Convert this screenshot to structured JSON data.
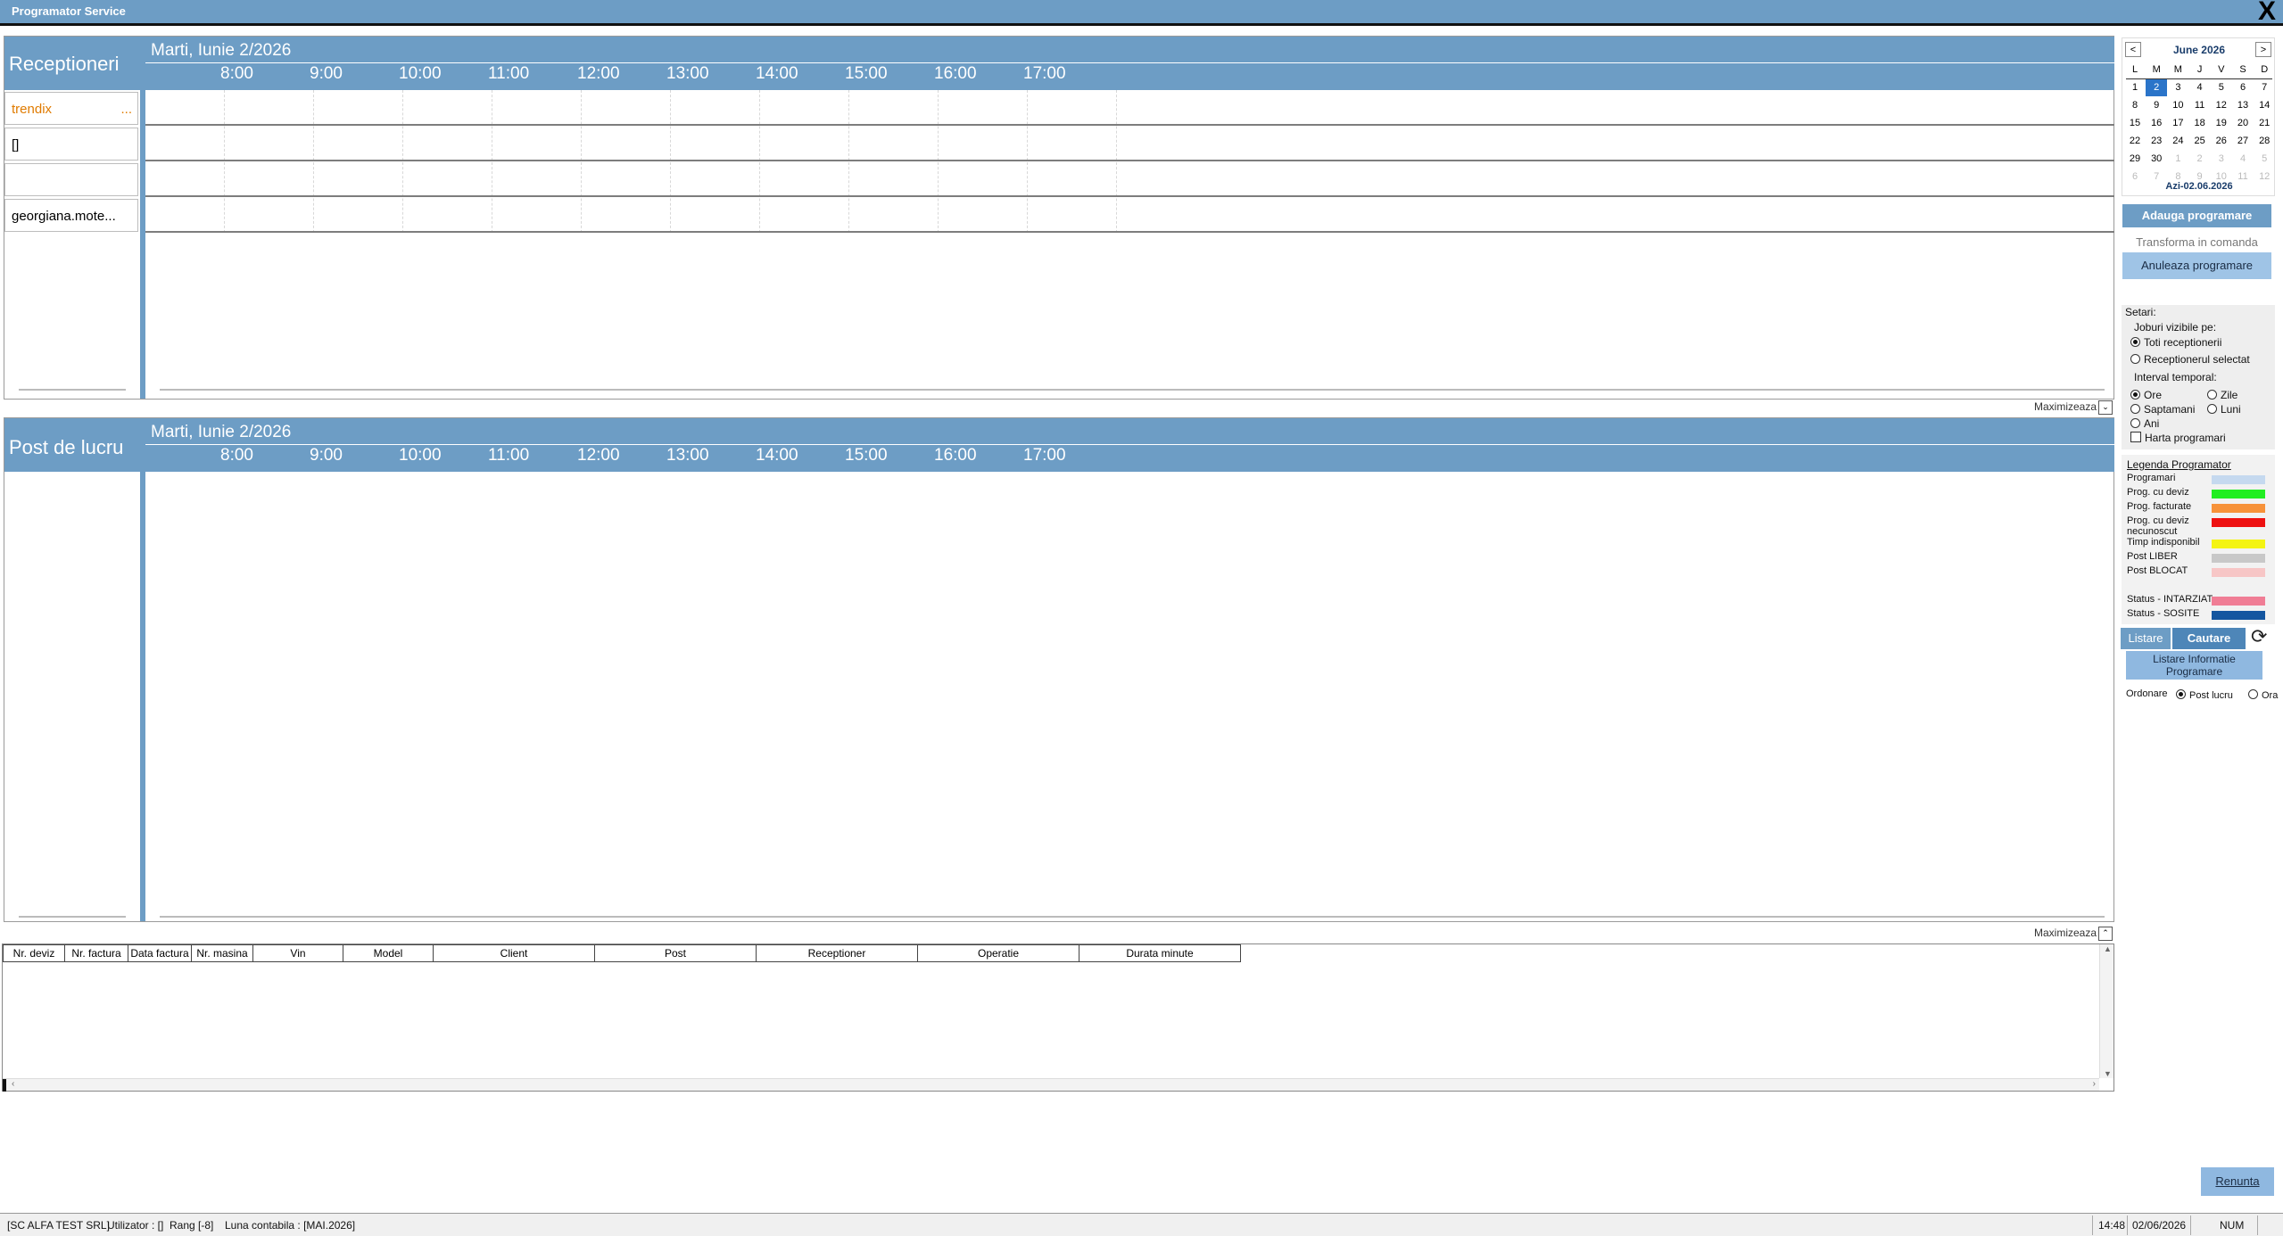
{
  "window": {
    "title": "Programator Service",
    "close_label": "X"
  },
  "top_panel": {
    "label": "Receptioneri",
    "date": "Marti, Iunie 2/2026",
    "hours": [
      "8:00",
      "9:00",
      "10:00",
      "11:00",
      "12:00",
      "13:00",
      "14:00",
      "15:00",
      "16:00",
      "17:00"
    ],
    "receptioneri": [
      {
        "name": "trendix",
        "more": "...",
        "color": "#e07b00"
      },
      {
        "name": "[]",
        "more": "",
        "color": "#000000"
      },
      {
        "name": "",
        "more": "",
        "color": "#000000"
      },
      {
        "name": "georgiana.mote...",
        "more": "",
        "color": "#000000"
      }
    ],
    "maximize_label": "Maximizeaza"
  },
  "bottom_panel": {
    "label": "Post de lucru",
    "date": "Marti, Iunie 2/2026",
    "hours": [
      "8:00",
      "9:00",
      "10:00",
      "11:00",
      "12:00",
      "13:00",
      "14:00",
      "15:00",
      "16:00",
      "17:00"
    ],
    "maximize_label": "Maximizeaza"
  },
  "table": {
    "columns": [
      "Nr. deviz",
      "Nr. factura",
      "Data factura",
      "Nr. masina",
      "Vin",
      "Model",
      "Client",
      "Post",
      "Receptioner",
      "Operatie",
      "Durata minute"
    ],
    "rows": []
  },
  "calendar": {
    "month_label": "June 2026",
    "prev_label": "<",
    "next_label": ">",
    "weekdays": [
      "L",
      "M",
      "M",
      "J",
      "V",
      "S",
      "D"
    ],
    "weeks": [
      [
        "1",
        "2",
        "3",
        "4",
        "5",
        "6",
        "7"
      ],
      [
        "8",
        "9",
        "10",
        "11",
        "12",
        "13",
        "14"
      ],
      [
        "15",
        "16",
        "17",
        "18",
        "19",
        "20",
        "21"
      ],
      [
        "22",
        "23",
        "24",
        "25",
        "26",
        "27",
        "28"
      ],
      [
        "29",
        "30",
        "1",
        "2",
        "3",
        "4",
        "5"
      ],
      [
        "6",
        "7",
        "8",
        "9",
        "10",
        "11",
        "12"
      ]
    ],
    "selected_day": "2",
    "today_label": "Azi-02.06.2026"
  },
  "actions": {
    "add": "Adauga programare",
    "transform": "Transforma in comanda",
    "cancel": "Anuleaza programare"
  },
  "settings": {
    "title": "Setari:",
    "visible_jobs_label": "Joburi vizibile pe:",
    "visible_jobs_options": [
      "Toti receptionerii",
      "Receptionerul selectat"
    ],
    "visible_jobs_selected": "Toti receptionerii",
    "interval_label": "Interval temporal:",
    "interval_options": [
      "Ore",
      "Zile",
      "Saptamani",
      "Luni",
      "Ani"
    ],
    "interval_selected": "Ore",
    "map_checkbox": "Harta programari",
    "map_checked": false
  },
  "legend": {
    "title": "Legenda Programator",
    "items": [
      {
        "label": "Programari",
        "color": "#c5d9ef"
      },
      {
        "label": "Prog. cu deviz",
        "color": "#22ee22"
      },
      {
        "label": "Prog. facturate",
        "color": "#f7923a"
      },
      {
        "label": "Prog. cu deviz necunoscut",
        "color": "#ee1111"
      },
      {
        "label": "Timp indisponibil",
        "color": "#f4f412"
      },
      {
        "label": "Post LIBER",
        "color": "#c8c8c8"
      },
      {
        "label": "Post BLOCAT",
        "color": "#f7c6c6"
      },
      {
        "label": "Status - INTARZIAT",
        "color": "#f07d95"
      },
      {
        "label": "Status - SOSITE",
        "color": "#1456a0"
      }
    ]
  },
  "tabs": {
    "listare": "Listare",
    "cautare": "Cautare"
  },
  "listing": {
    "button": "Listare Informatie Programare",
    "order_label": "Ordonare",
    "order_options": [
      "Post lucru",
      "Ora"
    ],
    "order_selected": "Post lucru"
  },
  "footer": {
    "renunta": "Renunta"
  },
  "statusbar": {
    "company": "[SC ALFA TEST SRL]",
    "user": "Utilizator : []",
    "rang": "Rang [-8]",
    "luna": "Luna contabila : [MAI.2026]",
    "time": "14:48",
    "date": "02/06/2026",
    "num": "NUM"
  }
}
